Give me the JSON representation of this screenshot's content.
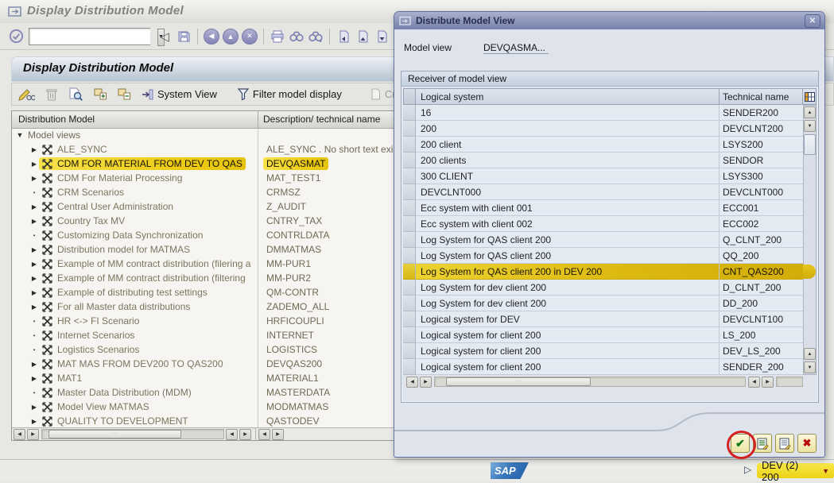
{
  "window": {
    "titlebar": "Display Distribution Model",
    "page_title": "Display Distribution Model"
  },
  "toolbar": {
    "command_value": ""
  },
  "app_toolbar": {
    "system_view_label": "System View",
    "filter_label": "Filter model display",
    "create_label": "Create model v"
  },
  "tree": {
    "col1_header": "Distribution Model",
    "col2_header": "Description/ technical name",
    "root_label": "Model views",
    "items": [
      {
        "expander": "arrow",
        "label": "ALE_SYNC",
        "desc": "ALE_SYNC  . No short text exi",
        "highlight": false
      },
      {
        "expander": "arrow",
        "label": "CDM FOR MATERIAL FROM DEV TO QAS",
        "desc": "DEVQASMAT",
        "highlight": true
      },
      {
        "expander": "arrow",
        "label": "CDM For Material Processing",
        "desc": "MAT_TEST1",
        "highlight": false
      },
      {
        "expander": "dot",
        "label": "CRM Scenarios",
        "desc": "CRMSZ",
        "highlight": false
      },
      {
        "expander": "arrow",
        "label": "Central User Administration",
        "desc": "Z_AUDIT",
        "highlight": false
      },
      {
        "expander": "arrow",
        "label": "Country Tax MV",
        "desc": "CNTRY_TAX",
        "highlight": false
      },
      {
        "expander": "dot",
        "label": "Customizing Data Synchronization",
        "desc": "CONTRLDATA",
        "highlight": false
      },
      {
        "expander": "arrow",
        "label": "Distribution model for MATMAS",
        "desc": "DMMATMAS",
        "highlight": false
      },
      {
        "expander": "arrow",
        "label": "Example of MM contract distribution (filering a",
        "desc": "MM-PUR1",
        "highlight": false
      },
      {
        "expander": "arrow",
        "label": "Example of MM contract distribution (filtering",
        "desc": "MM-PUR2",
        "highlight": false
      },
      {
        "expander": "arrow",
        "label": "Example of distributing test settings",
        "desc": "QM-CONTR",
        "highlight": false
      },
      {
        "expander": "arrow",
        "label": "For all Master data distributions",
        "desc": "ZADEMO_ALL",
        "highlight": false
      },
      {
        "expander": "dot",
        "label": "HR <-> FI Scenario",
        "desc": "HRFICOUPLI",
        "highlight": false
      },
      {
        "expander": "dot",
        "label": "Internet Scenarios",
        "desc": "INTERNET",
        "highlight": false
      },
      {
        "expander": "dot",
        "label": "Logistics Scenarios",
        "desc": "LOGISTICS",
        "highlight": false
      },
      {
        "expander": "arrow",
        "label": "MAT MAS FROM DEV200 TO QAS200",
        "desc": "DEVQAS200",
        "highlight": false
      },
      {
        "expander": "arrow",
        "label": "MAT1",
        "desc": "MATERIAL1",
        "highlight": false
      },
      {
        "expander": "dot",
        "label": "Master Data Distribution (MDM)",
        "desc": "MASTERDATA",
        "highlight": false
      },
      {
        "expander": "arrow",
        "label": "Model View MATMAS",
        "desc": "MODMATMAS",
        "highlight": false
      },
      {
        "expander": "arrow",
        "label": "QUALITY TO DEVELOPMENT",
        "desc": "QASTODEV",
        "highlight": false
      }
    ]
  },
  "dialog": {
    "title": "Distribute Model View",
    "model_view_label": "Model view",
    "model_view_value": "DEVQASMA...",
    "group_title": "Receiver of model view",
    "col1_header": "Logical system",
    "col2_header": "Technical name",
    "rows": [
      {
        "logical": "16",
        "technical": "SENDER200",
        "highlight": false
      },
      {
        "logical": "200",
        "technical": "DEVCLNT200",
        "highlight": false
      },
      {
        "logical": "200 client",
        "technical": "LSYS200",
        "highlight": false
      },
      {
        "logical": "200 clients",
        "technical": "SENDOR",
        "highlight": false
      },
      {
        "logical": "300 CLIENT",
        "technical": "LSYS300",
        "highlight": false
      },
      {
        "logical": "DEVCLNT000",
        "technical": "DEVCLNT000",
        "highlight": false
      },
      {
        "logical": "Ecc system with client 001",
        "technical": "ECC001",
        "highlight": false
      },
      {
        "logical": "Ecc system with client 002",
        "technical": "ECC002",
        "highlight": false
      },
      {
        "logical": "Log System for QAS client 200",
        "technical": "Q_CLNT_200",
        "highlight": false
      },
      {
        "logical": "Log System for QAS client 200",
        "technical": "QQ_200",
        "highlight": false
      },
      {
        "logical": "Log System for QAS client 200 in DEV 200",
        "technical": "CNT_QAS200",
        "highlight": true
      },
      {
        "logical": "Log System for dev client 200",
        "technical": "D_CLNT_200",
        "highlight": false
      },
      {
        "logical": "Log System for dev client 200",
        "technical": "DD_200",
        "highlight": false
      },
      {
        "logical": "Logical system for DEV",
        "technical": "DEVCLNT100",
        "highlight": false
      },
      {
        "logical": "Logical system for client 200",
        "technical": "LS_200",
        "highlight": false
      },
      {
        "logical": "Logical system for client 200",
        "technical": "DEV_LS_200",
        "highlight": false
      },
      {
        "logical": "Logical system for client 200",
        "technical": "SENDER_200",
        "highlight": false
      }
    ]
  },
  "statusbar": {
    "system_client": "DEV (2) 200",
    "sap_logo": "SAP"
  },
  "colors": {
    "highlight_yellow": "#f2da2e",
    "marker_orange": "#dcb90f",
    "dialog_title_bar": "#7b86ad",
    "sap_blue": "#3a77bb",
    "annotation_red": "#d32020"
  }
}
